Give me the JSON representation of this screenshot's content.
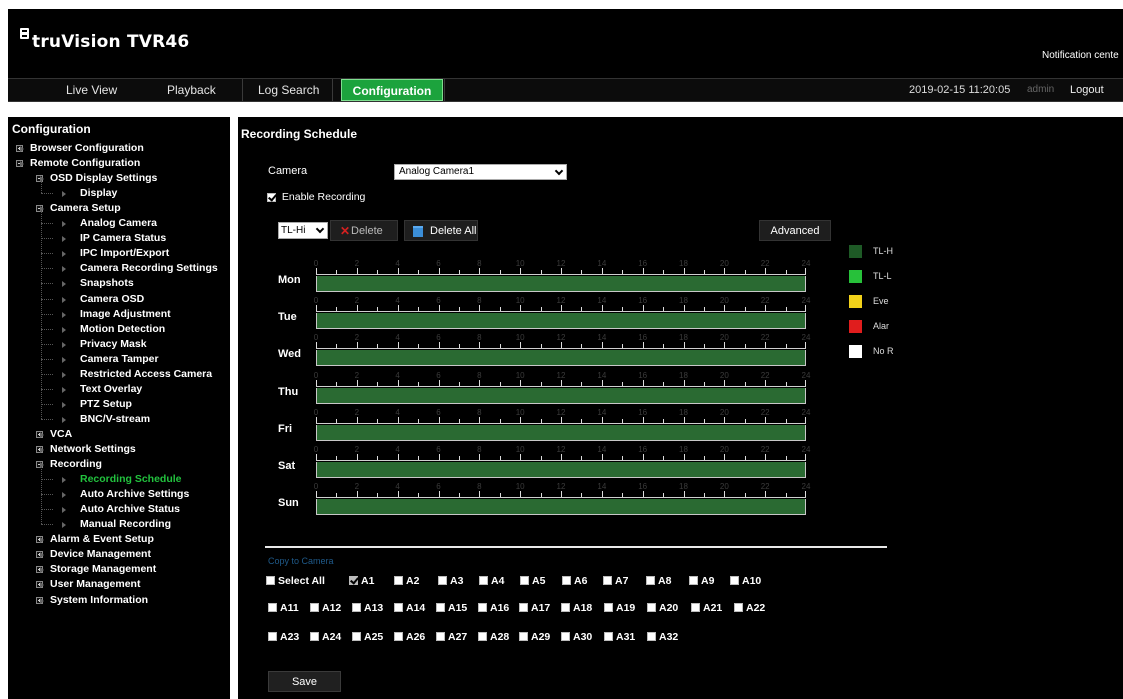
{
  "header": {
    "logo_text": "truVision TVR46",
    "notification": "Notification cente"
  },
  "nav": {
    "tabs": [
      "Live View",
      "Playback",
      "Log Search",
      "Configuration"
    ],
    "datetime": "2019-02-15 11:20:05",
    "user": "admin",
    "logout": "Logout"
  },
  "sidebar": {
    "title": "Configuration",
    "items": [
      "Browser Configuration",
      "Remote Configuration",
      "OSD Display Settings",
      "Display",
      "Camera Setup",
      "Analog Camera",
      "IP Camera Status",
      "IPC Import/Export",
      "Camera Recording Settings",
      "Snapshots",
      "Camera OSD",
      "Image Adjustment",
      "Motion Detection",
      "Privacy Mask",
      "Camera Tamper",
      "Restricted Access Camera",
      "Text Overlay",
      "PTZ Setup",
      "BNC/V-stream",
      "VCA",
      "Network Settings",
      "Recording",
      "Recording Schedule",
      "Auto Archive Settings",
      "Auto Archive Status",
      "Manual Recording",
      "Alarm & Event Setup",
      "Device Management",
      "Storage Management",
      "User Management",
      "System Information"
    ],
    "active_item": "Recording Schedule"
  },
  "main": {
    "title": "Recording Schedule",
    "camera_label": "Camera",
    "camera_value": "Analog Camera1",
    "enable_recording_label": "Enable Recording",
    "enable_recording_checked": true,
    "record_type": "TL-Hi",
    "delete_label": "Delete",
    "delete_all_label": "Delete All",
    "advanced_label": "Advanced",
    "days": [
      "Mon",
      "Tue",
      "Wed",
      "Thu",
      "Fri",
      "Sat",
      "Sun"
    ],
    "hour_labels": [
      "0",
      "2",
      "4",
      "6",
      "8",
      "10",
      "12",
      "14",
      "16",
      "18",
      "20",
      "22",
      "24"
    ],
    "legend": [
      {
        "label": "TL-H",
        "color": "#1e5a26"
      },
      {
        "label": "TL-L",
        "color": "#27c13a"
      },
      {
        "label": "Eve",
        "color": "#f2d21a"
      },
      {
        "label": "Alar",
        "color": "#e01d1d"
      },
      {
        "label": "No R",
        "color": "#ffffff"
      }
    ],
    "schedule_color": "#2a6a32",
    "copy_to_camera_label": "Copy to Camera",
    "select_all_label": "Select All",
    "cameras": [
      "A1",
      "A2",
      "A3",
      "A4",
      "A5",
      "A6",
      "A7",
      "A8",
      "A9",
      "A10",
      "A11",
      "A12",
      "A13",
      "A14",
      "A15",
      "A16",
      "A17",
      "A18",
      "A19",
      "A20",
      "A21",
      "A22",
      "A23",
      "A24",
      "A25",
      "A26",
      "A27",
      "A28",
      "A29",
      "A30",
      "A31",
      "A32"
    ],
    "checked_camera": "A1",
    "save_label": "Save"
  }
}
